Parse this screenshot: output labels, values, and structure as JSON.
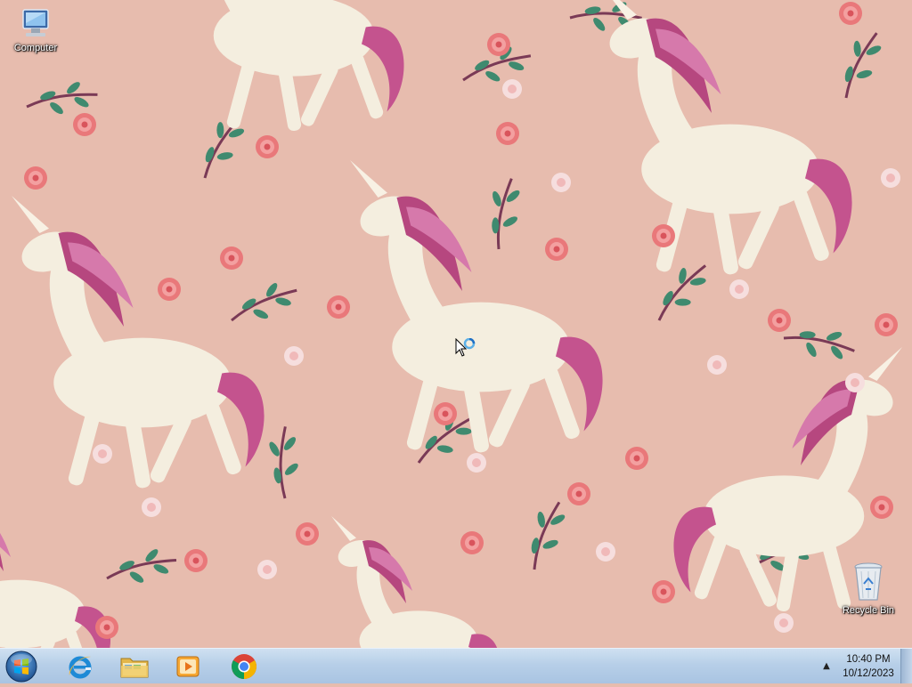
{
  "desktop": {
    "wallpaper": "unicorn-floral-pattern",
    "background_color": "#e7bcae",
    "icons": [
      {
        "label": "Computer",
        "icon": "computer-icon"
      },
      {
        "label": "Recycle Bin",
        "icon": "recycle-bin-icon"
      }
    ]
  },
  "taskbar": {
    "start_icon": "windows-start-orb",
    "pinned": [
      {
        "name": "Internet Explorer",
        "icon": "internet-explorer-icon"
      },
      {
        "name": "Windows Explorer",
        "icon": "folder-icon"
      },
      {
        "name": "Windows Media Player",
        "icon": "media-player-icon"
      },
      {
        "name": "Google Chrome",
        "icon": "chrome-icon"
      }
    ],
    "tray": {
      "show_hidden_icon": "▲",
      "time": "10:40 PM",
      "date": "10/12/2023"
    }
  },
  "cursor": "busy-pointer-icon"
}
